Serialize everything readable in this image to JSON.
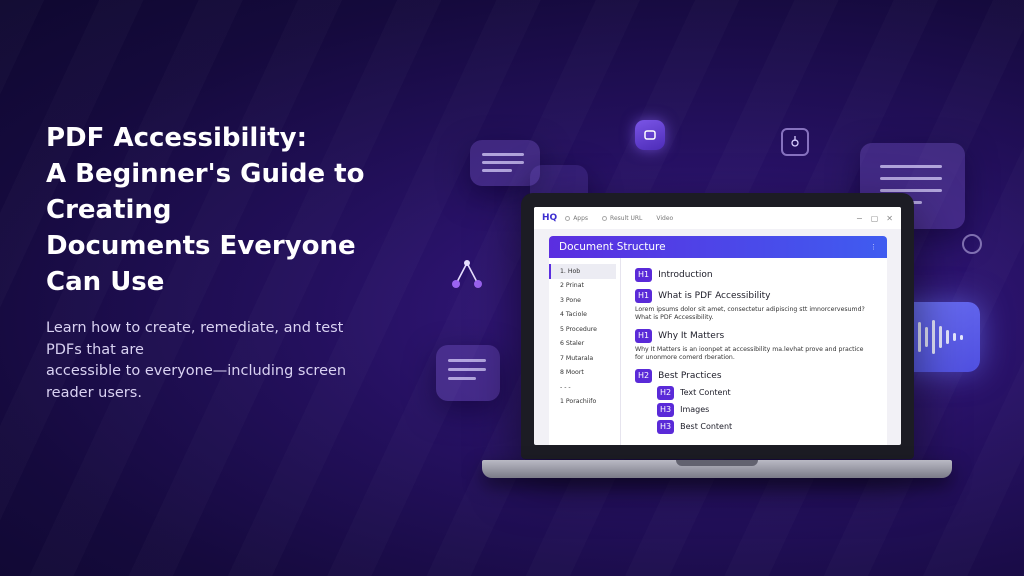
{
  "hero": {
    "title_lines": [
      "PDF Accessibility:",
      "A Beginner's Guide to",
      "Creating",
      "Documents Everyone",
      "Can Use"
    ],
    "subtitle_lines": [
      "Learn how to create, remediate, and test",
      "PDFs that are",
      "accessible to everyone—including screen",
      "reader users."
    ]
  },
  "app": {
    "logo": "HQ",
    "nav": [
      "Apps",
      "Result URL",
      "Video"
    ],
    "window_controls": [
      "−",
      "▢",
      "✕"
    ]
  },
  "panel": {
    "title": "Document Structure",
    "menu_icon": "more-icon",
    "sidebar": [
      "1. Hob",
      "2  Prinat",
      "3  Pone",
      "4  Taciole",
      "5  Procedure",
      "6  Staler",
      "7  Mutarala",
      "8  Moort",
      "- - -",
      "1  Porachiifo"
    ],
    "headings": [
      {
        "tag": "H1",
        "text": "Introduction"
      },
      {
        "tag": "H1",
        "text": "What is PDF Accessibility"
      },
      {
        "tag": "H1",
        "text": "Why It Matters"
      },
      {
        "tag": "H2",
        "text": "Best Practices"
      },
      {
        "tag": "H2",
        "text": "Text Content"
      },
      {
        "tag": "H3",
        "text": "Images"
      },
      {
        "tag": "H3",
        "text": "Best Content"
      }
    ],
    "para1": [
      "Lorem ipsums dolor sit amet, consectetur adipiscing stt imnorcervesumd?",
      "What is PDF Accessibility."
    ],
    "para2": [
      "Why It Matters is an ioonpet at accessibility ma.levhat prove and practice",
      "for unonmore comerd rberation."
    ]
  },
  "colors": {
    "accent": "#5a2ad8",
    "header_gradient_start": "#5b2ee0",
    "header_gradient_end": "#3f5cf0",
    "background": "#24105e"
  }
}
